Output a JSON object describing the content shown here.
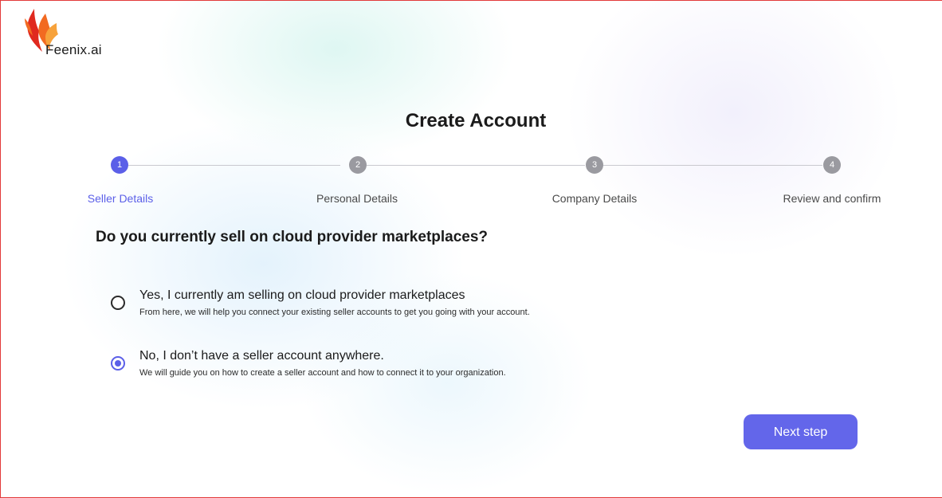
{
  "brand": {
    "name": "Feenix.ai",
    "colors": {
      "flame_dark": "#e0291f",
      "flame_mid": "#f26a21",
      "flame_light": "#f7a23b"
    }
  },
  "page": {
    "title": "Create Account"
  },
  "stepper": {
    "steps": [
      {
        "number": "1",
        "label": "Seller Details",
        "state": "active"
      },
      {
        "number": "2",
        "label": "Personal Details",
        "state": "inactive"
      },
      {
        "number": "3",
        "label": "Company Details",
        "state": "inactive"
      },
      {
        "number": "4",
        "label": "Review and confirm",
        "state": "inactive"
      }
    ],
    "active_color": "#5b5fe8",
    "inactive_color": "#9a9aa0"
  },
  "question": {
    "text": "Do you currently sell on cloud provider marketplaces?",
    "options": [
      {
        "title": "Yes, I currently am selling on cloud provider marketplaces",
        "description": "From here, we will help you connect your existing seller accounts to get you going with your account.",
        "selected": false
      },
      {
        "title": "No, I don’t have a seller account anywhere.",
        "description": "We will guide you on how to create a seller account and how to connect it to your organization.",
        "selected": true
      }
    ]
  },
  "actions": {
    "next_label": "Next step",
    "next_color": "#6366ea"
  }
}
